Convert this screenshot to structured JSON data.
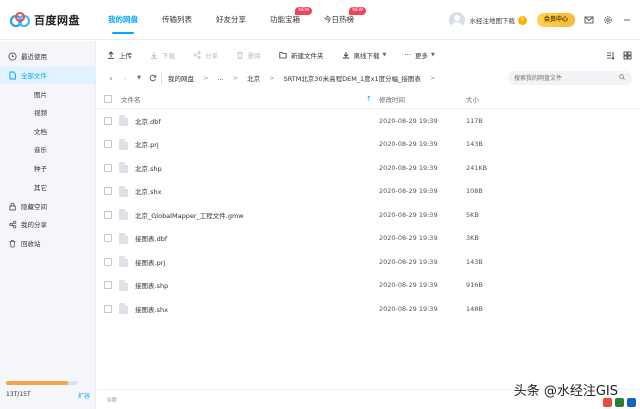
{
  "app": {
    "brand": "百度网盘",
    "brand_color": "#06a7ff"
  },
  "nav": {
    "items": [
      {
        "label": "我的网盘",
        "active": true
      },
      {
        "label": "传输列表"
      },
      {
        "label": "好友分享"
      },
      {
        "label": "功能宝箱",
        "badge": "NEW"
      },
      {
        "label": "今日热榜",
        "badge": "NEW"
      }
    ]
  },
  "user": {
    "name": "水经注地图下载",
    "vip_mark": "5",
    "member_label": "会员中心"
  },
  "sidebar": {
    "items": [
      {
        "label": "最近使用",
        "icon": "clock-icon"
      },
      {
        "label": "全部文件",
        "icon": "file-icon",
        "active": true
      },
      {
        "label": "图片"
      },
      {
        "label": "视频"
      },
      {
        "label": "文档"
      },
      {
        "label": "音乐"
      },
      {
        "label": "种子"
      },
      {
        "label": "其它"
      },
      {
        "label": "隐藏空间",
        "icon": "lock-icon"
      },
      {
        "label": "我的分享",
        "icon": "share-icon"
      },
      {
        "label": "回收站",
        "icon": "trash-icon"
      }
    ],
    "quota": {
      "text": "13T/15T",
      "used_fraction": 0.867,
      "expand_label": "扩容"
    }
  },
  "toolbar": {
    "upload": "上传",
    "download": "下载",
    "share": "分享",
    "delete": "删除",
    "new_folder": "新建文件夹",
    "offline_download": "离线下载",
    "more": "更多"
  },
  "path": {
    "crumbs": [
      "我的网盘",
      "...",
      "北京",
      "SRTM北京30米高程DEM_1度x1度分幅_接图表"
    ],
    "search_placeholder": "搜索我的网盘文件"
  },
  "list": {
    "headers": {
      "name": "文件名",
      "time": "修改时间",
      "size": "大小"
    },
    "files": [
      {
        "name": "北京.dbf",
        "time": "2020-08-29 19:39",
        "size": "117B"
      },
      {
        "name": "北京.prj",
        "time": "2020-08-29 19:39",
        "size": "143B"
      },
      {
        "name": "北京.shp",
        "time": "2020-08-29 19:39",
        "size": "241KB"
      },
      {
        "name": "北京.shx",
        "time": "2020-08-29 19:39",
        "size": "108B"
      },
      {
        "name": "北京_GlobalMapper_工程文件.gmw",
        "time": "2020-08-29 19:39",
        "size": "5KB"
      },
      {
        "name": "接图表.dbf",
        "time": "2020-08-29 19:39",
        "size": "3KB"
      },
      {
        "name": "接图表.prj",
        "time": "2020-08-29 19:39",
        "size": "143B"
      },
      {
        "name": "接图表.shp",
        "time": "2020-08-29 19:39",
        "size": "916B"
      },
      {
        "name": "接图表.shx",
        "time": "2020-08-29 19:39",
        "size": "148B"
      }
    ],
    "count_text": "9项"
  },
  "watermark": {
    "text": "头条 @水经注GIS"
  }
}
